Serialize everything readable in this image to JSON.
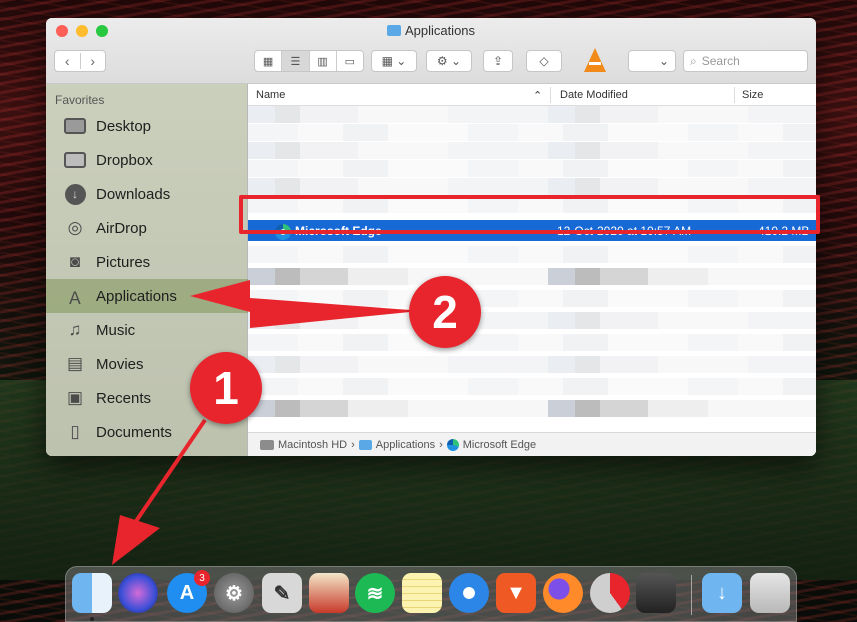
{
  "window": {
    "title": "Applications"
  },
  "toolbar": {
    "back": "‹",
    "forward": "›",
    "view_icons": "▦",
    "view_list": "☰",
    "view_columns": "▥",
    "view_gallery": "▭",
    "group": "▦ ⌄",
    "action": "⚙ ⌄",
    "share": "⇪",
    "tag": "◇",
    "dropdown": "⌄",
    "search_placeholder": "Search"
  },
  "sidebar": {
    "section": "Favorites",
    "items": [
      {
        "label": "Desktop",
        "icon": "desktop-icon"
      },
      {
        "label": "Dropbox",
        "icon": "folder-icon"
      },
      {
        "label": "Downloads",
        "icon": "downloads-icon"
      },
      {
        "label": "AirDrop",
        "icon": "airdrop-icon"
      },
      {
        "label": "Pictures",
        "icon": "camera-icon"
      },
      {
        "label": "Applications",
        "icon": "applications-icon"
      },
      {
        "label": "Music",
        "icon": "music-note-icon"
      },
      {
        "label": "Movies",
        "icon": "film-icon"
      },
      {
        "label": "Recents",
        "icon": "recents-icon"
      },
      {
        "label": "Documents",
        "icon": "document-icon"
      }
    ],
    "selected": "Applications"
  },
  "list": {
    "columns": [
      "Name",
      "Date Modified",
      "Size"
    ],
    "selected_row": {
      "name": "Microsoft Edge",
      "date_modified": "12-Oct-2020 at 10:57 AM",
      "size": "410.2 MB"
    }
  },
  "pathbar": {
    "segments": [
      "Macintosh HD",
      "Applications",
      "Microsoft Edge"
    ],
    "separator": "›"
  },
  "annotations": {
    "step1": "1",
    "step2": "2",
    "color": "#e8252c"
  },
  "dock": {
    "app_store_badge": "3",
    "apps": [
      "finder-icon",
      "siri-icon",
      "app-store-icon",
      "system-preferences-icon",
      "script-editor-icon",
      "popcorn-time-icon",
      "spotify-icon",
      "notes-icon",
      "safari-icon",
      "brave-icon",
      "firefox-icon",
      "progress-icon",
      "photo-booth-icon",
      "downloads-folder-icon",
      "trash-icon"
    ]
  }
}
